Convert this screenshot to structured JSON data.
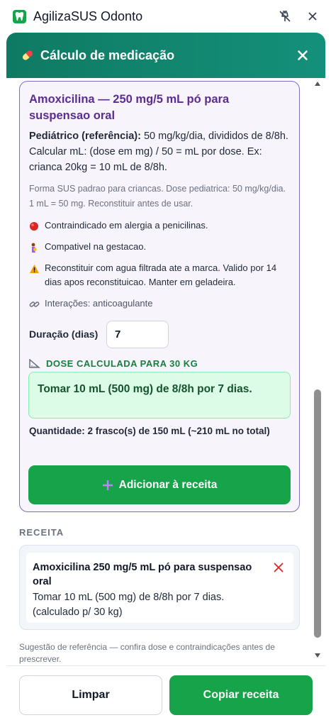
{
  "titlebar": {
    "app_title": "AgilizaSUS Odonto",
    "logo_icon": "tooth-icon",
    "pin_icon": "pin-off-icon",
    "close_icon": "close-icon"
  },
  "modal": {
    "title": "Cálculo de medicação",
    "title_icon": "pill-icon",
    "header_color": "#0f7a63"
  },
  "medication": {
    "name": "Amoxicilina — 250 mg/5 mL pó para suspensao oral",
    "ped_label": "Pediátrico (referência):",
    "ped_text": " 50 mg/kg/dia, divididos de 8/8h. Calcular mL: (dose em mg) / 50 = mL por dose. Ex: crianca 20kg = 10 mL de 8/8h.",
    "note": "Forma SUS padrao para criancas. Dose pediatrica: 50 mg/kg/dia. 1 mL = 50 mg. Reconstituir antes de usar.",
    "warnings": [
      {
        "icon": "red-circle-icon",
        "text": "Contraindicado em alergia a penicilinas."
      },
      {
        "icon": "pregnant-woman-icon",
        "text": "Compativel na gestacao."
      },
      {
        "icon": "warning-icon",
        "text": "Reconstituir com agua filtrada ate a marca. Valido por 14 dias apos reconstituicao. Manter em geladeira."
      },
      {
        "icon": "link-icon",
        "text": "Interações: anticoagulante"
      }
    ],
    "duration_label": "Duração (dias)",
    "duration_value": "7",
    "dose_heading": "DOSE CALCULADA PARA 30 KG",
    "dose_heading_icon": "triangle-ruler-icon",
    "dose_result": "Tomar 10 mL (500 mg) de 8/8h por 7 dias.",
    "quantity": "Quantidade: 2 frasco(s) de 150 mL (~210 mL no total)",
    "add_button": "Adicionar à receita",
    "add_icon": "plus-icon"
  },
  "receita": {
    "label": "RECEITA",
    "items": [
      {
        "title": "Amoxicilina 250 mg/5 mL pó para suspensao oral",
        "detail": "Tomar 10 mL (500 mg) de 8/8h por 7 dias. (calculado p/ 30 kg)"
      }
    ]
  },
  "footer_note": "Sugestão de referência — confira dose e contraindicações antes de prescrever.",
  "actions": {
    "clear": "Limpar",
    "copy": "Copiar receita"
  },
  "colors": {
    "accent_green": "#16a34a",
    "teal_header": "#0f7a63",
    "purple_title": "#5b2c91",
    "card_border": "#7c6cc4"
  }
}
